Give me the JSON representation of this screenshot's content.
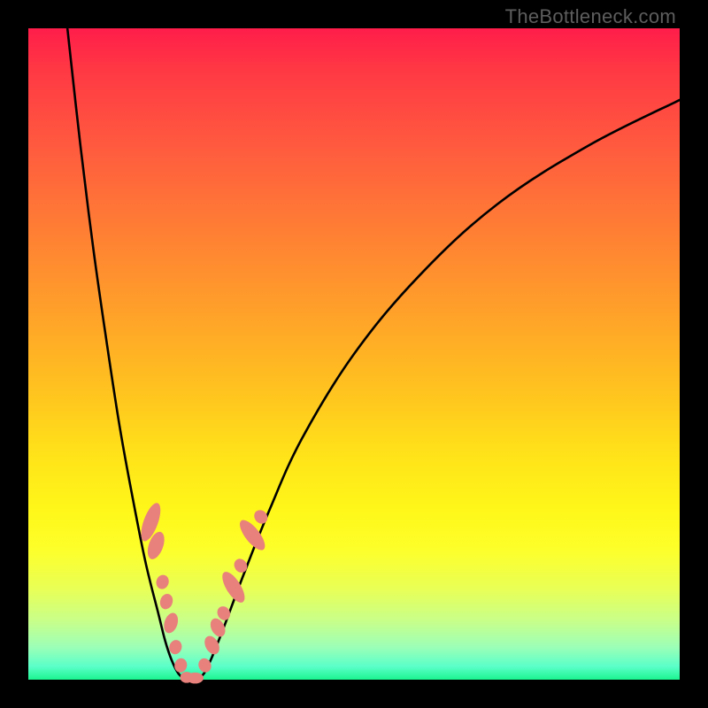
{
  "watermark": "TheBottleneck.com",
  "chart_data": {
    "type": "line",
    "title": "",
    "xlabel": "",
    "ylabel": "",
    "xlim": [
      0,
      100
    ],
    "ylim": [
      0,
      100
    ],
    "grid": false,
    "legend": false,
    "series": [
      {
        "name": "left-curve",
        "x": [
          6,
          8,
          10,
          12,
          14,
          16,
          18,
          20,
          21,
          22,
          23,
          24
        ],
        "y": [
          100,
          82,
          66,
          52,
          39,
          28,
          18,
          10,
          6,
          3,
          1,
          0
        ]
      },
      {
        "name": "right-curve",
        "x": [
          26,
          27,
          28,
          30,
          33,
          37,
          42,
          50,
          60,
          72,
          86,
          100
        ],
        "y": [
          0,
          1,
          3,
          8,
          16,
          26,
          37,
          50,
          62,
          73,
          82,
          89
        ]
      }
    ],
    "markers": [
      {
        "name": "left-dots",
        "color": "#e8817c",
        "points": [
          {
            "x": 18.8,
            "y": 24.2,
            "rx": 1.1,
            "ry": 3.1,
            "rot": 20
          },
          {
            "x": 19.6,
            "y": 20.6,
            "rx": 1.1,
            "ry": 2.2,
            "rot": 20
          },
          {
            "x": 20.6,
            "y": 15.0,
            "rx": 0.95,
            "ry": 1.1,
            "rot": 18
          },
          {
            "x": 21.2,
            "y": 12.0,
            "rx": 0.95,
            "ry": 1.2,
            "rot": 18
          },
          {
            "x": 21.9,
            "y": 8.7,
            "rx": 1.0,
            "ry": 1.6,
            "rot": 18
          },
          {
            "x": 22.6,
            "y": 5.0,
            "rx": 0.95,
            "ry": 1.1,
            "rot": 16
          },
          {
            "x": 23.4,
            "y": 2.2,
            "rx": 0.95,
            "ry": 1.1,
            "rot": 14
          }
        ]
      },
      {
        "name": "right-dots",
        "color": "#e8817c",
        "points": [
          {
            "x": 27.1,
            "y": 2.2,
            "rx": 0.95,
            "ry": 1.1,
            "rot": -25
          },
          {
            "x": 28.2,
            "y": 5.3,
            "rx": 1.0,
            "ry": 1.5,
            "rot": -28
          },
          {
            "x": 29.1,
            "y": 8.0,
            "rx": 1.0,
            "ry": 1.5,
            "rot": -28
          },
          {
            "x": 30.0,
            "y": 10.2,
            "rx": 0.95,
            "ry": 1.1,
            "rot": -30
          },
          {
            "x": 31.5,
            "y": 14.2,
            "rx": 1.1,
            "ry": 2.7,
            "rot": -32
          },
          {
            "x": 32.6,
            "y": 17.5,
            "rx": 0.95,
            "ry": 1.1,
            "rot": -34
          },
          {
            "x": 34.4,
            "y": 22.2,
            "rx": 1.1,
            "ry": 2.8,
            "rot": -38
          },
          {
            "x": 35.7,
            "y": 25.0,
            "rx": 0.95,
            "ry": 1.1,
            "rot": -40
          }
        ]
      },
      {
        "name": "bottom-dots",
        "color": "#e8817c",
        "points": [
          {
            "x": 24.3,
            "y": 0.35,
            "rx": 1.0,
            "ry": 0.85,
            "rot": 0
          },
          {
            "x": 25.6,
            "y": 0.25,
            "rx": 1.3,
            "ry": 0.85,
            "rot": 0
          }
        ]
      }
    ]
  }
}
